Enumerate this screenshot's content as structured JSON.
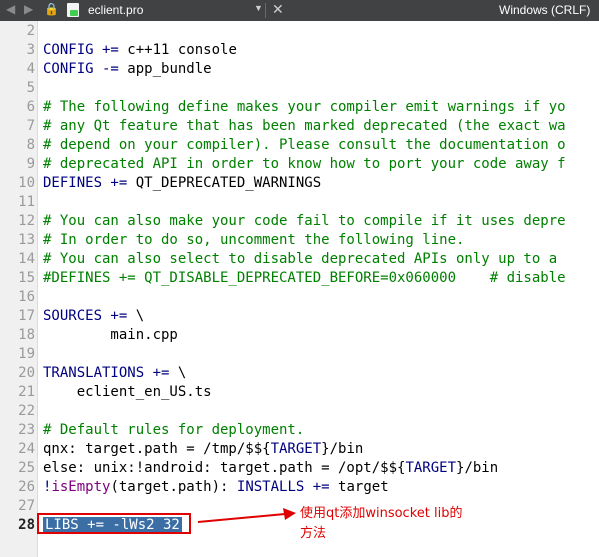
{
  "tab": {
    "file_name": "eclient.pro",
    "encoding": "Windows (CRLF)"
  },
  "lines": [
    {
      "n": "2",
      "segs": [
        {
          "t": ""
        }
      ]
    },
    {
      "n": "3",
      "segs": [
        {
          "t": "CONFIG += ",
          "c": "kw"
        },
        {
          "t": "c++11 console"
        }
      ]
    },
    {
      "n": "4",
      "segs": [
        {
          "t": "CONFIG -= ",
          "c": "kw"
        },
        {
          "t": "app_bundle"
        }
      ]
    },
    {
      "n": "5",
      "segs": [
        {
          "t": ""
        }
      ]
    },
    {
      "n": "6",
      "segs": [
        {
          "t": "# The following define makes your compiler emit warnings if yo",
          "c": "cm"
        }
      ]
    },
    {
      "n": "7",
      "segs": [
        {
          "t": "# any Qt feature that has been marked deprecated (the exact wa",
          "c": "cm"
        }
      ]
    },
    {
      "n": "8",
      "segs": [
        {
          "t": "# depend on your compiler). Please consult the documentation o",
          "c": "cm"
        }
      ]
    },
    {
      "n": "9",
      "segs": [
        {
          "t": "# deprecated API in order to know how to port your code away f",
          "c": "cm"
        }
      ]
    },
    {
      "n": "10",
      "segs": [
        {
          "t": "DEFINES += ",
          "c": "kw"
        },
        {
          "t": "QT_DEPRECATED_WARNINGS"
        }
      ]
    },
    {
      "n": "11",
      "segs": [
        {
          "t": ""
        }
      ]
    },
    {
      "n": "12",
      "segs": [
        {
          "t": "# You can also make your code fail to compile if it uses depre",
          "c": "cm"
        }
      ]
    },
    {
      "n": "13",
      "segs": [
        {
          "t": "# In order to do so, uncomment the following line.",
          "c": "cm"
        }
      ]
    },
    {
      "n": "14",
      "segs": [
        {
          "t": "# You can also select to disable deprecated APIs only up to a ",
          "c": "cm"
        }
      ]
    },
    {
      "n": "15",
      "segs": [
        {
          "t": "#DEFINES += QT_DISABLE_DEPRECATED_BEFORE=0x060000    # disable",
          "c": "cm"
        }
      ]
    },
    {
      "n": "16",
      "segs": [
        {
          "t": ""
        }
      ]
    },
    {
      "n": "17",
      "segs": [
        {
          "t": "SOURCES += ",
          "c": "kw"
        },
        {
          "t": "\\"
        }
      ]
    },
    {
      "n": "18",
      "segs": [
        {
          "t": "        main.cpp"
        }
      ]
    },
    {
      "n": "19",
      "segs": [
        {
          "t": ""
        }
      ]
    },
    {
      "n": "20",
      "segs": [
        {
          "t": "TRANSLATIONS += ",
          "c": "kw"
        },
        {
          "t": "\\"
        }
      ]
    },
    {
      "n": "21",
      "segs": [
        {
          "t": "    eclient_en_US.ts"
        }
      ]
    },
    {
      "n": "22",
      "segs": [
        {
          "t": ""
        }
      ]
    },
    {
      "n": "23",
      "segs": [
        {
          "t": "# Default rules for deployment.",
          "c": "cm"
        }
      ]
    },
    {
      "n": "24",
      "segs": [
        {
          "t": "qnx: target.path = /tmp/$${"
        },
        {
          "t": "TARGET",
          "c": "kw"
        },
        {
          "t": "}/bin"
        }
      ]
    },
    {
      "n": "25",
      "segs": [
        {
          "t": "else: unix:!android: target.path = /opt/$${"
        },
        {
          "t": "TARGET",
          "c": "kw"
        },
        {
          "t": "}/bin"
        }
      ]
    },
    {
      "n": "26",
      "segs": [
        {
          "t": "!",
          "c": "kw"
        },
        {
          "t": "isEmpty",
          "c": "fn"
        },
        {
          "t": "(target.path): "
        },
        {
          "t": "INSTALLS += ",
          "c": "kw"
        },
        {
          "t": "target"
        }
      ]
    },
    {
      "n": "27",
      "segs": [
        {
          "t": ""
        }
      ]
    },
    {
      "n": "28",
      "current": true,
      "segs": [
        {
          "t": "LIBS += -lWs2_32",
          "c": "sel"
        }
      ]
    }
  ],
  "annotation": {
    "text_line1": "使用qt添加winsocket lib的",
    "text_line2": "方法",
    "color": "#e00000"
  }
}
